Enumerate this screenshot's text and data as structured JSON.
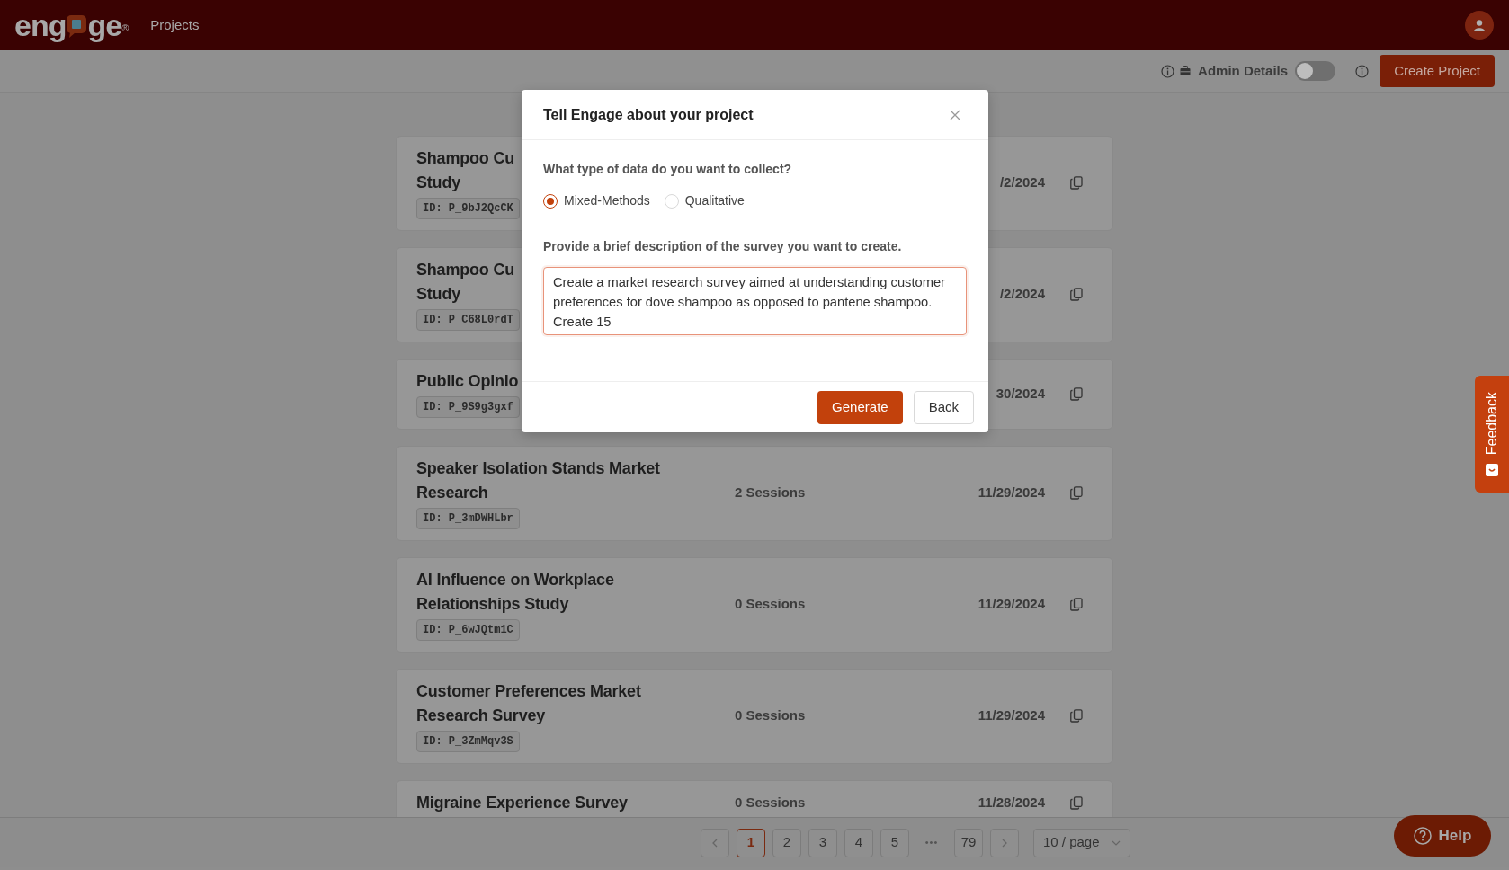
{
  "header": {
    "logo": {
      "before": "eng",
      "after": "ge",
      "mark": "®"
    },
    "nav": [
      {
        "label": "Projects"
      }
    ]
  },
  "toolbar": {
    "admin_label": "Admin Details",
    "admin_toggle": {
      "on": false
    },
    "create_button": "Create Project"
  },
  "projects": [
    {
      "title_lines": [
        "Shampoo Cu",
        "Study"
      ],
      "id": "ID: P_9bJ2QcCK",
      "date": "/2/2024"
    },
    {
      "title_lines": [
        "Shampoo Cu",
        "Study"
      ],
      "id": "ID: P_C68L0rdT",
      "date": "/2/2024"
    },
    {
      "title_lines": [
        "Public Opinio"
      ],
      "id": "ID: P_9S9g3gxf",
      "date": "30/2024"
    },
    {
      "title_lines": [
        "Speaker Isolation Stands Market",
        "Research"
      ],
      "id": "ID: P_3mDWHLbr",
      "sessions": "2 Sessions",
      "date": "11/29/2024"
    },
    {
      "title_lines": [
        "AI Influence on Workplace",
        "Relationships Study"
      ],
      "id": "ID: P_6wJQtm1C",
      "sessions": "0 Sessions",
      "date": "11/29/2024"
    },
    {
      "title_lines": [
        "Customer Preferences Market",
        "Research Survey"
      ],
      "id": "ID: P_3ZmMqv3S",
      "sessions": "0 Sessions",
      "date": "11/29/2024"
    },
    {
      "title_lines": [
        "Migraine Experience Survey"
      ],
      "sessions": "0 Sessions",
      "date": "11/28/2024"
    }
  ],
  "pagination": {
    "pages": [
      {
        "label": "1",
        "selected": true
      },
      {
        "label": "2",
        "selected": false
      },
      {
        "label": "3",
        "selected": false
      },
      {
        "label": "4",
        "selected": false
      },
      {
        "label": "5",
        "selected": false
      }
    ],
    "ellipsis": "•••",
    "last": "79",
    "page_size": "10 / page"
  },
  "modal": {
    "title": "Tell Engage about your project",
    "question": "What type of data do you want to collect?",
    "options": [
      {
        "label": "Mixed-Methods",
        "selected": true
      },
      {
        "label": "Qualitative",
        "selected": false
      }
    ],
    "description_label": "Provide a brief description of the survey you want to create.",
    "description": "Create a market research survey aimed at understanding customer preferences for dove shampoo as opposed to pantene shampoo. Create 15 ",
    "buttons": [
      {
        "label": "Generate",
        "kind": "primary"
      },
      {
        "label": "Back",
        "kind": "secondary"
      }
    ]
  },
  "feedback": "Feedback",
  "help": "Help"
}
